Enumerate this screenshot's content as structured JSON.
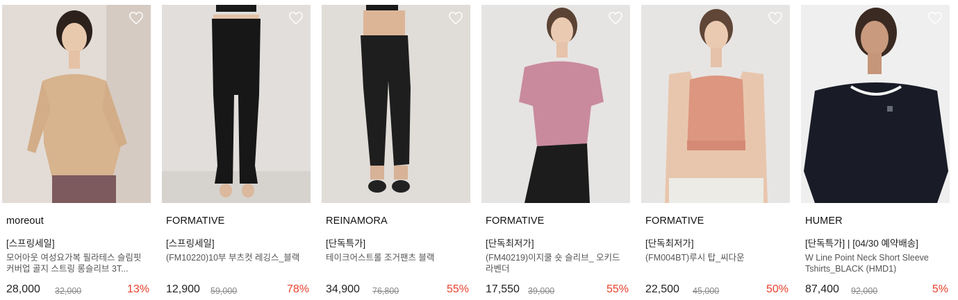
{
  "colors": {
    "discount": "#e8412c",
    "heart_stroke": "#ffffff"
  },
  "icons": {
    "wishlist": "heart-icon"
  },
  "products": [
    {
      "brand": "moreout",
      "tag": "[스프링세일]",
      "name": "모어아웃 여성요가복 필라테스 슬림핏 커버업 골지 스트링 롱슬리브 3T...",
      "price": "28,000",
      "original_price": "32,000",
      "discount": "13%"
    },
    {
      "brand": "FORMATIVE",
      "tag": "[스프링세일]",
      "name": "(FM10220)10부 부츠컷 레깅스_블랙",
      "price": "12,900",
      "original_price": "59,000",
      "discount": "78%"
    },
    {
      "brand": "REINAMORA",
      "tag": "[단독특가]",
      "name": "테이크어스트롤 조거팬츠 블랙",
      "price": "34,900",
      "original_price": "76,800",
      "discount": "55%"
    },
    {
      "brand": "FORMATIVE",
      "tag": "[단독최저가]",
      "name": "(FM40219)이지쿨 숏 슬리브_ 오키드 라벤더",
      "price": "17,550",
      "original_price": "39,000",
      "discount": "55%"
    },
    {
      "brand": "FORMATIVE",
      "tag": "[단독최저가]",
      "name": "(FM004BT)루시 탑_씨다운",
      "price": "22,500",
      "original_price": "45,000",
      "discount": "50%"
    },
    {
      "brand": "HUMER",
      "tag": "[단독특가] | [04/30 예약배송]",
      "name": "W Line Point Neck Short Sleeve Tshirts_BLACK (HMD1)",
      "price": "87,400",
      "original_price": "92,000",
      "discount": "5%"
    }
  ]
}
